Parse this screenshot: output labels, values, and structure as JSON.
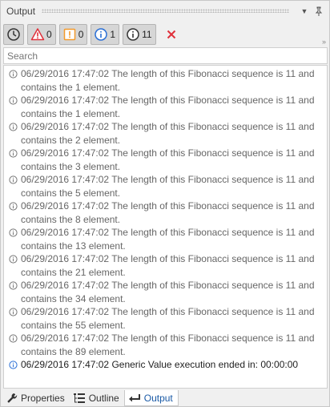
{
  "panel": {
    "title": "Output"
  },
  "filters": {
    "warnings_count": "0",
    "errors_count": "0",
    "info_count": "1",
    "trace_count": "11"
  },
  "search": {
    "placeholder": "Search"
  },
  "log": {
    "entries": [
      "06/29/2016 17:47:02 The length of this Fibonacci sequence is 11 and contains the 1 element.",
      "06/29/2016 17:47:02 The length of this Fibonacci sequence is 11 and contains the 1 element.",
      "06/29/2016 17:47:02 The length of this Fibonacci sequence is 11 and contains the 2 element.",
      "06/29/2016 17:47:02 The length of this Fibonacci sequence is 11 and contains the 3 element.",
      "06/29/2016 17:47:02 The length of this Fibonacci sequence is 11 and contains the 5 element.",
      "06/29/2016 17:47:02 The length of this Fibonacci sequence is 11 and contains the 8 element.",
      "06/29/2016 17:47:02 The length of this Fibonacci sequence is 11 and contains the 13 element.",
      "06/29/2016 17:47:02 The length of this Fibonacci sequence is 11 and contains the 21 element.",
      "06/29/2016 17:47:02 The length of this Fibonacci sequence is 11 and contains the 34 element.",
      "06/29/2016 17:47:02 The length of this Fibonacci sequence is 11 and contains the 55 element.",
      "06/29/2016 17:47:02 The length of this Fibonacci sequence is 11 and contains the 89 element.",
      "06/29/2016 17:47:02 Generic Value execution ended in: 00:00:00"
    ]
  },
  "tabs": {
    "properties": "Properties",
    "outline": "Outline",
    "output": "Output"
  },
  "colors": {
    "error": "#e0303a",
    "warning": "#f39a2b",
    "info": "#2a6fd6",
    "trace": "#333333",
    "active_tab": "#1a5aa6"
  },
  "icons": {
    "timestamp": "clock-icon",
    "errors": "error-triangle-icon",
    "warnings": "warning-icon",
    "info": "info-icon",
    "trace": "trace-icon",
    "clear": "clear-x-icon"
  }
}
